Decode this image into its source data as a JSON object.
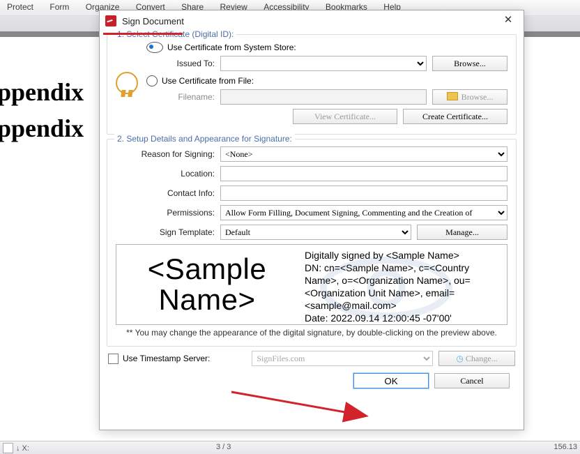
{
  "menubar": [
    "Protect",
    "Form",
    "Organize",
    "Convert",
    "Share",
    "Review",
    "Accessibility",
    "Bookmarks",
    "Help"
  ],
  "bg_text": {
    "line1": "ppendix",
    "line2": "ppendix"
  },
  "dialog": {
    "title": "Sign Document",
    "section1_title": "1. Select Certificate (Digital ID):",
    "radio_system": "Use Certificate from System Store:",
    "issued_to_label": "Issued To:",
    "issued_to_value": "",
    "browse1": "Browse...",
    "radio_file": "Use Certificate from File:",
    "filename_label": "Filename:",
    "filename_value": "",
    "browse2": "Browse...",
    "view_cert": "View Certificate...",
    "create_cert": "Create Certificate...",
    "section2_title": "2. Setup Details and Appearance for Signature:",
    "reason_label": "Reason for Signing:",
    "reason_value": "<None>",
    "location_label": "Location:",
    "location_value": "",
    "contact_label": "Contact Info:",
    "contact_value": "",
    "permissions_label": "Permissions:",
    "permissions_value": "Allow Form Filling, Document Signing, Commenting and the Creation of",
    "template_label": "Sign Template:",
    "template_value": "Default",
    "manage_btn": "Manage...",
    "preview_name": "<Sample Name>",
    "preview_lines": "Digitally signed by <Sample Name>\nDN: cn=<Sample Name>, c=<Country Name>, o=<Organization Name>, ou=<Organization Unit Name>, email=<sample@mail.com>\nDate: 2022.09.14 12:00:45 -07'00'",
    "note": "** You may change the appearance of the digital signature, by double-clicking on the preview above.",
    "tss_check_label": "Use Timestamp Server:",
    "tss_value": "SignFiles.com",
    "tss_change": "Change...",
    "ok": "OK",
    "cancel": "Cancel"
  },
  "statusbar": {
    "xy": "↓ X:",
    "page": "3 / 3",
    "zoom": "156.13"
  },
  "annotation": {
    "underline_target": "dialog-title",
    "arrow_target": "ok-button"
  }
}
